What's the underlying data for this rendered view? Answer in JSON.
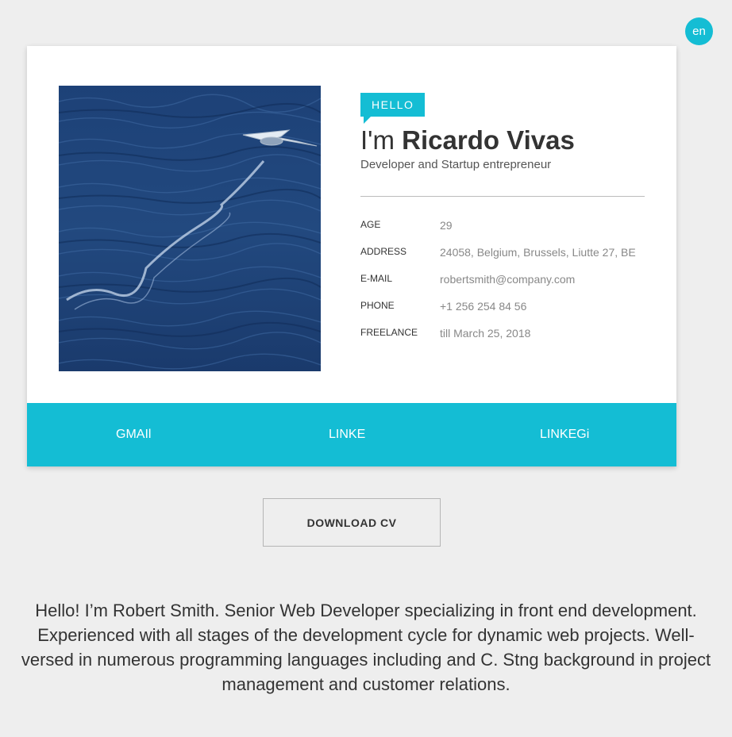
{
  "language_badge": "en",
  "profile": {
    "hello_tag": "HELLO",
    "name_prefix": "I'm ",
    "name": "Ricardo Vivas",
    "tagline": "Developer and Startup entrepreneur",
    "details": [
      {
        "label": "AGE",
        "value": "29"
      },
      {
        "label": "ADDRESS",
        "value": "24058, Belgium, Brussels, Liutte 27, BE"
      },
      {
        "label": "E-MAIL",
        "value": "robertsmith@company.com"
      },
      {
        "label": "PHONE",
        "value": "+1 256 254 84 56"
      },
      {
        "label": "FREELANCE",
        "value": "till March 25, 2018"
      }
    ]
  },
  "social_links": [
    "GMAIl",
    "LINKE",
    "LINKEGi"
  ],
  "download_button": "DOWNLOAD CV",
  "about_lines": [
    "Hello! I’m Robert Smith. Senior Web Developer specializing in front end development.",
    "Experienced with all stages of the development cycle for dynamic web projects. Well-",
    "versed in numerous programming languages including and C. Stng background in project",
    "management and customer relations."
  ],
  "colors": {
    "accent": "#14bdd4",
    "background": "#eeeeee",
    "card": "#ffffff"
  }
}
